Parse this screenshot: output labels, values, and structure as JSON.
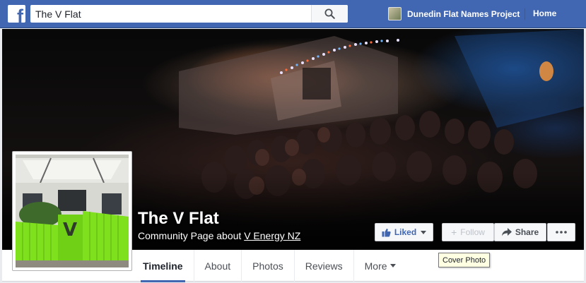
{
  "topbar": {
    "logo_letter": "f",
    "search_value": "The V Flat",
    "profile_name": "Dunedin Flat Names Project",
    "home_label": "Home",
    "accent_color": "#4267b2"
  },
  "page": {
    "name": "The V Flat",
    "subtitle_prefix": "Community Page about ",
    "subtitle_link": "V Energy NZ",
    "profile_pic_letter": "V"
  },
  "actions": {
    "liked_label": "Liked",
    "follow_label": "Follow",
    "share_label": "Share",
    "more_icon": "ellipsis-icon"
  },
  "tooltip": "Cover Photo",
  "tabs": [
    {
      "label": "Timeline",
      "active": true
    },
    {
      "label": "About"
    },
    {
      "label": "Photos"
    },
    {
      "label": "Reviews"
    },
    {
      "label": "More"
    }
  ]
}
